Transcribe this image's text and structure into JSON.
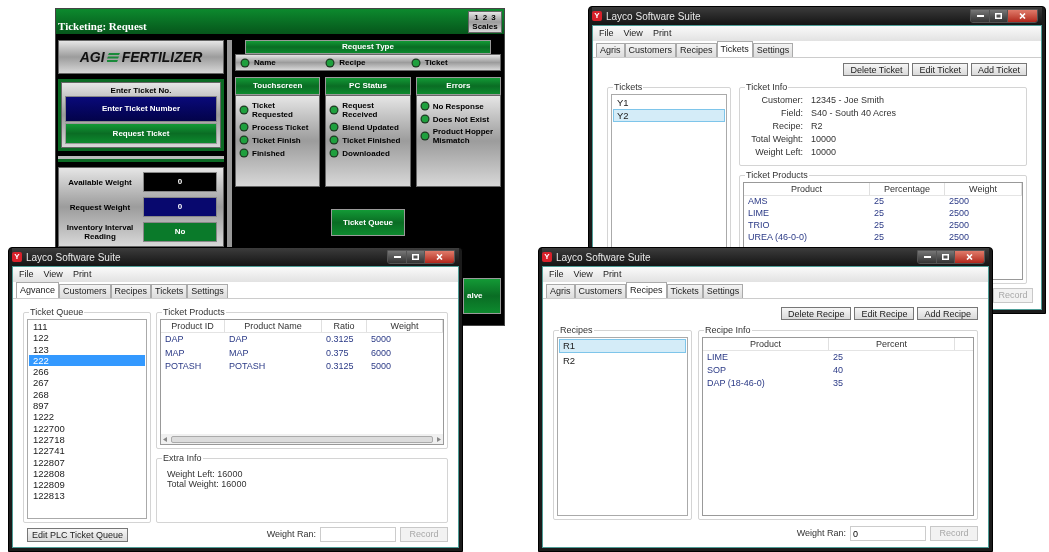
{
  "hmi": {
    "title": "Ticketing: Request",
    "scale_numbers": [
      "1",
      "2",
      "3"
    ],
    "scales_button": "Scales",
    "logo": {
      "left": "AGI",
      "right": "FERTILIZER"
    },
    "ticket_entry": {
      "label": "Enter Ticket No.",
      "field": "Enter Ticket Number",
      "button": "Request Ticket"
    },
    "weights": [
      {
        "kind": "readout",
        "label": "Available Weight",
        "value": "0"
      },
      {
        "kind": "entry",
        "label": "Request Weight",
        "value": "0"
      },
      {
        "kind": "toggle",
        "label": "Inventory Interval Reading",
        "value": "No"
      }
    ],
    "request_type": {
      "title": "Request Type",
      "options": [
        "Name",
        "Recipe",
        "Ticket"
      ]
    },
    "status_panels": [
      {
        "title": "Touchscreen",
        "items": [
          "Ticket Requested",
          "Process Ticket",
          "Ticket Finish",
          "Finished"
        ]
      },
      {
        "title": "PC Status",
        "items": [
          "Request Received",
          "Blend Updated",
          "Ticket Finished",
          "Downloaded"
        ]
      },
      {
        "title": "Errors",
        "items": [
          "No Response",
          "Does Not Exist",
          "Product Hopper Mismatch"
        ]
      }
    ],
    "queue_button": "Ticket Queue",
    "partial_button": "alve"
  },
  "tickets_window": {
    "logo_letter": "Y",
    "title": "Layco Software Suite",
    "menu": [
      "File",
      "View",
      "Print"
    ],
    "tabs": [
      {
        "label": "Agris",
        "selected": false
      },
      {
        "label": "Customers",
        "selected": false
      },
      {
        "label": "Recipes",
        "selected": false
      },
      {
        "label": "Tickets",
        "selected": true
      },
      {
        "label": "Settings",
        "selected": false
      }
    ],
    "actions": [
      "Delete Ticket",
      "Edit Ticket",
      "Add Ticket"
    ],
    "list_title": "Tickets",
    "list_focused": false,
    "list": [
      {
        "label": "Y1",
        "selected": false
      },
      {
        "label": "Y2",
        "selected": true
      }
    ],
    "info_title": "Ticket Info",
    "info": [
      {
        "label": "Customer:",
        "value": "12345 - Joe Smith"
      },
      {
        "label": "Field:",
        "value": "S40 - South 40 Acres"
      },
      {
        "label": "Recipe:",
        "value": "R2"
      },
      {
        "label": "Total Weight:",
        "value": "10000"
      },
      {
        "label": "Weight Left:",
        "value": "10000"
      }
    ],
    "products_title": "Ticket Products",
    "columns": [
      "Product",
      "Percentage",
      "Weight"
    ],
    "rows": [
      [
        "AMS",
        "25",
        "2500"
      ],
      [
        "LIME",
        "25",
        "2500"
      ],
      [
        "TRIO",
        "25",
        "2500"
      ],
      [
        "UREA (46-0-0)",
        "25",
        "2500"
      ]
    ],
    "record_button": {
      "label": "Record",
      "disabled": true
    }
  },
  "queue_window": {
    "logo_letter": "Y",
    "title": "Layco Software Suite",
    "menu": [
      "File",
      "View",
      "Print"
    ],
    "tabs": [
      {
        "label": "Agvance",
        "selected": true
      },
      {
        "label": "Customers",
        "selected": false
      },
      {
        "label": "Recipes",
        "selected": false
      },
      {
        "label": "Tickets",
        "selected": false
      },
      {
        "label": "Settings",
        "selected": false
      }
    ],
    "list_title": "Ticket Queue",
    "list_focused": true,
    "list": [
      {
        "label": "111",
        "selected": false
      },
      {
        "label": "122",
        "selected": false
      },
      {
        "label": "123",
        "selected": false
      },
      {
        "label": "222",
        "selected": true
      },
      {
        "label": "266",
        "selected": false
      },
      {
        "label": "267",
        "selected": false
      },
      {
        "label": "268",
        "selected": false
      },
      {
        "label": "897",
        "selected": false
      },
      {
        "label": "1222",
        "selected": false
      },
      {
        "label": "122700",
        "selected": false
      },
      {
        "label": "122718",
        "selected": false
      },
      {
        "label": "122741",
        "selected": false
      },
      {
        "label": "122807",
        "selected": false
      },
      {
        "label": "122808",
        "selected": false
      },
      {
        "label": "122809",
        "selected": false
      },
      {
        "label": "122813",
        "selected": false
      }
    ],
    "products_title": "Ticket Products",
    "columns": [
      "Product ID",
      "Product Name",
      "Ratio",
      "Weight"
    ],
    "rows": [
      [
        "DAP",
        "DAP",
        "0.3125",
        "5000"
      ],
      [
        "MAP",
        "MAP",
        "0.375",
        "6000"
      ],
      [
        "POTASH",
        "POTASH",
        "0.3125",
        "5000"
      ]
    ],
    "extra_title": "Extra Info",
    "extra_lines": [
      "Weight Left: 16000",
      "Total Weight: 16000"
    ],
    "edit_button": "Edit PLC Ticket Queue",
    "weight_label": "Weight Ran:",
    "record_button": {
      "label": "Record",
      "disabled": true
    }
  },
  "recipes_window": {
    "logo_letter": "Y",
    "title": "Layco Software Suite",
    "menu": [
      "File",
      "View",
      "Print"
    ],
    "tabs": [
      {
        "label": "Agris",
        "selected": false
      },
      {
        "label": "Customers",
        "selected": false
      },
      {
        "label": "Recipes",
        "selected": true
      },
      {
        "label": "Tickets",
        "selected": false
      },
      {
        "label": "Settings",
        "selected": false
      }
    ],
    "actions": [
      "Delete Recipe",
      "Edit Recipe",
      "Add Recipe"
    ],
    "list_title": "Recipes",
    "list_focused": false,
    "list": [
      {
        "label": "R1",
        "selected": true
      },
      {
        "label": "R2",
        "selected": false
      }
    ],
    "info_title": "Recipe Info",
    "columns": [
      "Product",
      "Percent"
    ],
    "rows": [
      [
        "LIME",
        "25"
      ],
      [
        "SOP",
        "40"
      ],
      [
        "DAP (18-46-0)",
        "35"
      ]
    ],
    "weight_label": "Weight Ran:",
    "weight_value": "0",
    "record_button": {
      "label": "Record",
      "disabled": true
    }
  }
}
